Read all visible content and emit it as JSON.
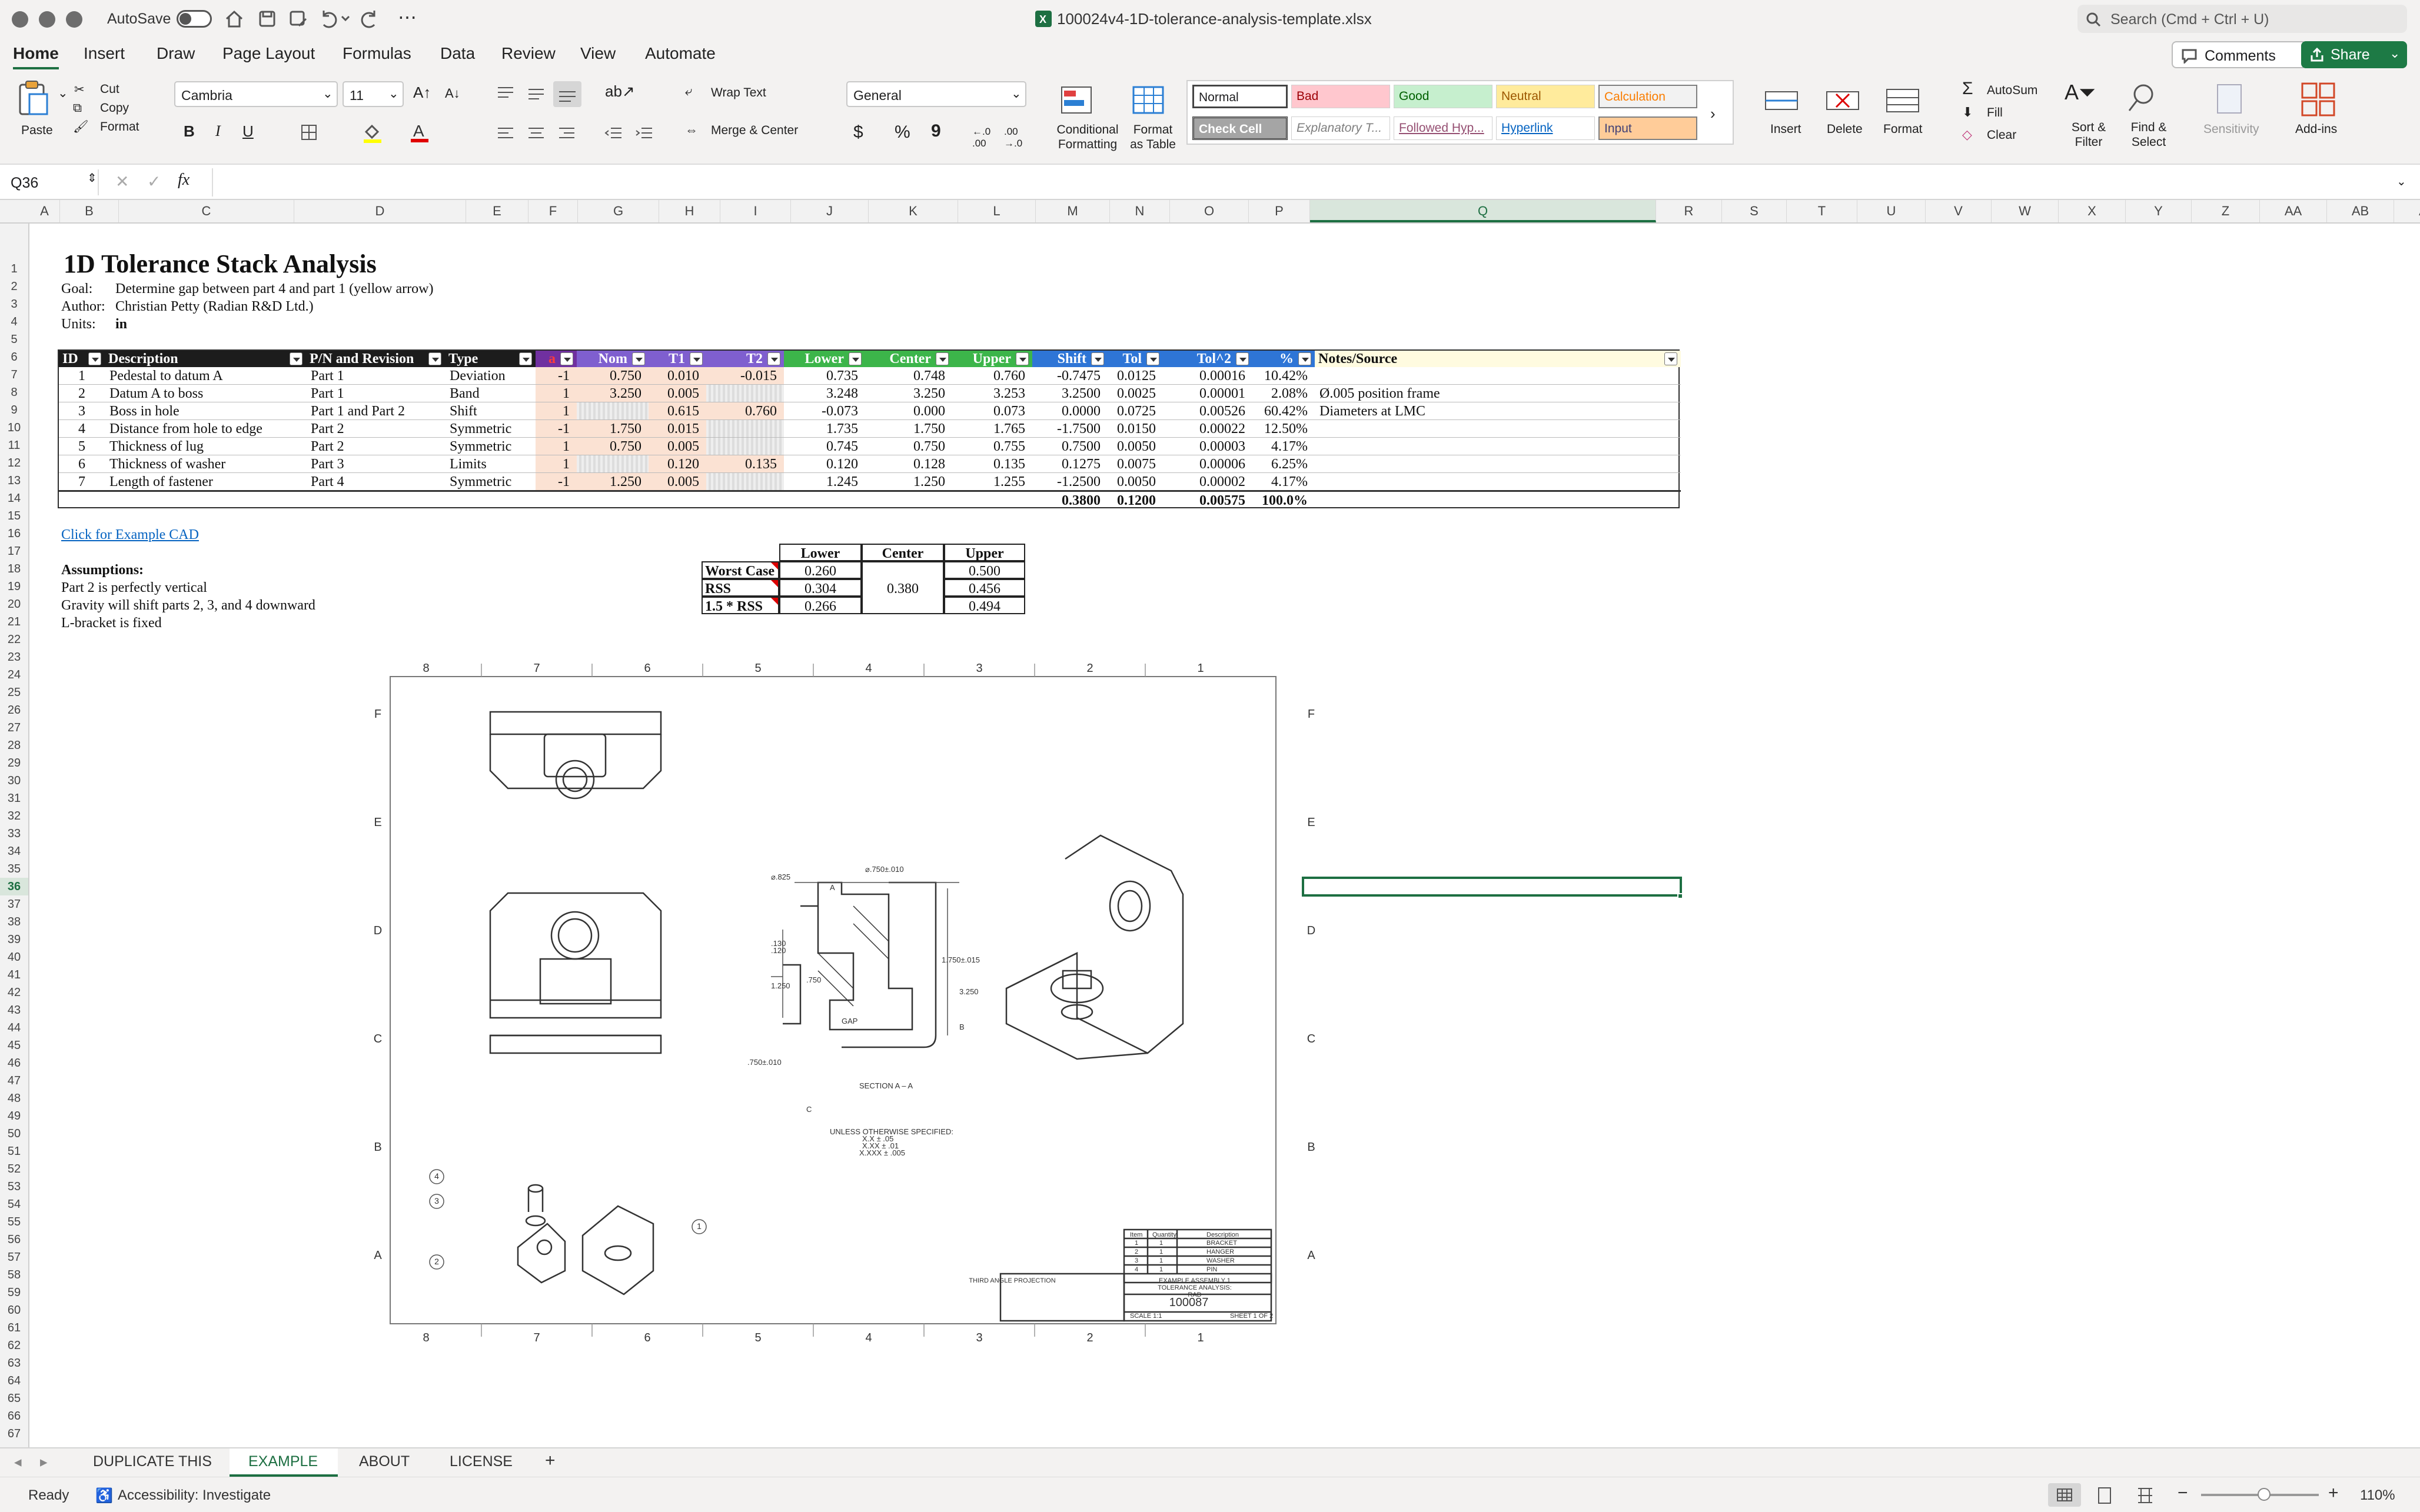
{
  "window": {
    "autosave": "AutoSave",
    "filename": "100024v4-1D-tolerance-analysis-template.xlsx",
    "search_placeholder": "Search (Cmd + Ctrl + U)"
  },
  "tabs": [
    "Home",
    "Insert",
    "Draw",
    "Page Layout",
    "Formulas",
    "Data",
    "Review",
    "View",
    "Automate"
  ],
  "comments_label": "Comments",
  "share_label": "Share",
  "ribbon": {
    "paste": "Paste",
    "cut": "Cut",
    "copy": "Copy",
    "format_painter": "Format",
    "font_name": "Cambria",
    "font_size": "11",
    "bold": "B",
    "italic": "I",
    "underline": "U",
    "wrap_text": "Wrap Text",
    "merge_center": "Merge & Center",
    "number_format": "General",
    "currency": "$",
    "percent": "%",
    "comma": "9",
    "conditional_formatting": [
      "Conditional",
      "Formatting"
    ],
    "format_as_table": [
      "Format",
      "as Table"
    ],
    "styles": [
      {
        "name": "Normal",
        "bg": "#ffffff",
        "fg": "#000000"
      },
      {
        "name": "Bad",
        "bg": "#ffc7ce",
        "fg": "#9c0006"
      },
      {
        "name": "Good",
        "bg": "#c6efce",
        "fg": "#006100"
      },
      {
        "name": "Neutral",
        "bg": "#ffeb9c",
        "fg": "#9c5700"
      },
      {
        "name": "Calculation",
        "bg": "#f2f2f2",
        "fg": "#fa7d00"
      },
      {
        "name": "Check Cell",
        "bg": "#a5a5a5",
        "fg": "#ffffff"
      },
      {
        "name": "Explanatory T...",
        "bg": "#ffffff",
        "fg": "#7f7f7f"
      },
      {
        "name": "Followed Hyp...",
        "bg": "#ffffff",
        "fg": "#954f72"
      },
      {
        "name": "Hyperlink",
        "bg": "#ffffff",
        "fg": "#0563c1"
      },
      {
        "name": "Input",
        "bg": "#ffcc99",
        "fg": "#3f3f76"
      }
    ],
    "insert": "Insert",
    "delete": "Delete",
    "format": "Format",
    "autosum": "AutoSum",
    "fill": "Fill",
    "clear": "Clear",
    "sort_filter": [
      "Sort &",
      "Filter"
    ],
    "find_select": [
      "Find &",
      "Select"
    ],
    "sensitivity": "Sensitivity",
    "addins": "Add-ins"
  },
  "formula_bar": {
    "name_box": "Q36",
    "fx": "fx",
    "value": ""
  },
  "columns": [
    "A",
    "B",
    "C",
    "D",
    "E",
    "F",
    "G",
    "H",
    "I",
    "J",
    "K",
    "L",
    "M",
    "N",
    "O",
    "P",
    "Q",
    "R",
    "S",
    "T",
    "U",
    "V",
    "W",
    "X",
    "Y",
    "Z",
    "AA",
    "AB",
    "A"
  ],
  "rows": [
    "1",
    "2",
    "3",
    "4",
    "5",
    "6",
    "7",
    "8",
    "9",
    "10",
    "11",
    "12",
    "13",
    "14",
    "15",
    "16",
    "17",
    "18",
    "19",
    "20",
    "21",
    "22",
    "23",
    "24",
    "25",
    "26",
    "27",
    "28",
    "29",
    "30",
    "31",
    "32",
    "33",
    "34",
    "35",
    "36",
    "37",
    "38",
    "39",
    "40",
    "41",
    "42",
    "43",
    "44",
    "45",
    "46",
    "47",
    "48",
    "49",
    "50",
    "51",
    "52",
    "53",
    "54",
    "55",
    "56",
    "57",
    "58",
    "59",
    "60",
    "61",
    "62",
    "63",
    "64",
    "65",
    "66",
    "67"
  ],
  "sheet": {
    "title": "1D Tolerance Stack Analysis",
    "meta": [
      [
        "Goal:",
        "Determine gap between part 4 and part 1 (yellow arrow)"
      ],
      [
        "Author:",
        "Christian Petty (Radian R&D Ltd.)"
      ],
      [
        "Units:",
        "in"
      ]
    ],
    "table_headers": [
      "ID",
      "Description",
      "P/N and Revision",
      "Type",
      "a",
      "Nom",
      "T1",
      "T2",
      "Lower",
      "Center",
      "Upper",
      "Shift",
      "Tol",
      "Tol^2",
      "%",
      "Notes/Source"
    ],
    "rows": [
      [
        "1",
        "Pedestal to datum A",
        "Part 1",
        "Deviation",
        "-1",
        "0.750",
        "0.010",
        "-0.015",
        "0.735",
        "0.748",
        "0.760",
        "-0.7475",
        "0.0125",
        "0.00016",
        "10.42%",
        ""
      ],
      [
        "2",
        "Datum A to boss",
        "Part 1",
        "Band",
        "1",
        "3.250",
        "0.005",
        "",
        "3.248",
        "3.250",
        "3.253",
        "3.2500",
        "0.0025",
        "0.00001",
        "2.08%",
        "Ø.005 position frame"
      ],
      [
        "3",
        "Boss in hole",
        "Part 1 and Part 2",
        "Shift",
        "1",
        "",
        "0.615",
        "0.760",
        "-0.073",
        "0.000",
        "0.073",
        "0.0000",
        "0.0725",
        "0.00526",
        "60.42%",
        "Diameters at LMC"
      ],
      [
        "4",
        "Distance from hole to edge",
        "Part 2",
        "Symmetric",
        "-1",
        "1.750",
        "0.015",
        "",
        "1.735",
        "1.750",
        "1.765",
        "-1.7500",
        "0.0150",
        "0.00022",
        "12.50%",
        ""
      ],
      [
        "5",
        "Thickness of lug",
        "Part 2",
        "Symmetric",
        "1",
        "0.750",
        "0.005",
        "",
        "0.745",
        "0.750",
        "0.755",
        "0.7500",
        "0.0050",
        "0.00003",
        "4.17%",
        ""
      ],
      [
        "6",
        "Thickness of washer",
        "Part 3",
        "Limits",
        "1",
        "",
        "0.120",
        "0.135",
        "0.120",
        "0.128",
        "0.135",
        "0.1275",
        "0.0075",
        "0.00006",
        "6.25%",
        ""
      ],
      [
        "7",
        "Length of fastener",
        "Part 4",
        "Symmetric",
        "-1",
        "1.250",
        "0.005",
        "",
        "1.245",
        "1.250",
        "1.255",
        "-1.2500",
        "0.0050",
        "0.00002",
        "4.17%",
        ""
      ]
    ],
    "totals": [
      "0.3800",
      "0.1200",
      "0.00575",
      "100.0%"
    ],
    "link": "Click for Example CAD",
    "assumptions_title": "Assumptions:",
    "assumptions": [
      "Part 2 is perfectly vertical",
      "Gravity will shift parts 2, 3, and 4 downward",
      "L-bracket is fixed"
    ],
    "summary": {
      "headers": [
        "Lower",
        "Center",
        "Upper"
      ],
      "rows": [
        [
          "Worst Case",
          "0.260",
          "0.500"
        ],
        [
          "RSS",
          "0.304",
          "0.456"
        ],
        [
          "1.5 * RSS",
          "0.266",
          "0.494"
        ]
      ],
      "center": "0.380"
    }
  },
  "drawing": {
    "col_labels": [
      "8",
      "7",
      "6",
      "5",
      "4",
      "3",
      "2",
      "1"
    ],
    "row_labels": [
      "F",
      "E",
      "D",
      "C",
      "B",
      "A"
    ],
    "dims": [
      "⌀.825",
      "⌀.750±.010",
      "1.750±.015",
      "3.250",
      ".130",
      ".120",
      "1.250",
      ".750",
      "GAP",
      ".750±.010",
      "SECTION A – A",
      "UNLESS OTHERWISE SPECIFIED:",
      "X.X ± .05",
      "X.XX ± .01",
      "X.XXX ± .005",
      "A",
      "B",
      "C"
    ],
    "bom_headers": [
      "Item",
      "Quantity",
      "Description"
    ],
    "bom": [
      [
        "1",
        "1",
        "BRACKET"
      ],
      [
        "2",
        "1",
        "HANGER"
      ],
      [
        "3",
        "1",
        "WASHER"
      ],
      [
        "4",
        "1",
        "PIN"
      ]
    ],
    "title_block": [
      "EXAMPLE ASSEMBLY 1",
      "TOLERANCE ANALYSIS:",
      "RAD",
      "THIRD ANGLE PROJECTION",
      "100087",
      "SCALE 1:1",
      "SHEET 1 OF 2"
    ],
    "balloons": [
      "1",
      "2",
      "3",
      "4"
    ]
  },
  "sheet_tabs": [
    "DUPLICATE THIS",
    "EXAMPLE",
    "ABOUT",
    "LICENSE"
  ],
  "active_sheet": "EXAMPLE",
  "status": {
    "ready": "Ready",
    "accessibility": "Accessibility: Investigate",
    "zoom": "110%"
  }
}
